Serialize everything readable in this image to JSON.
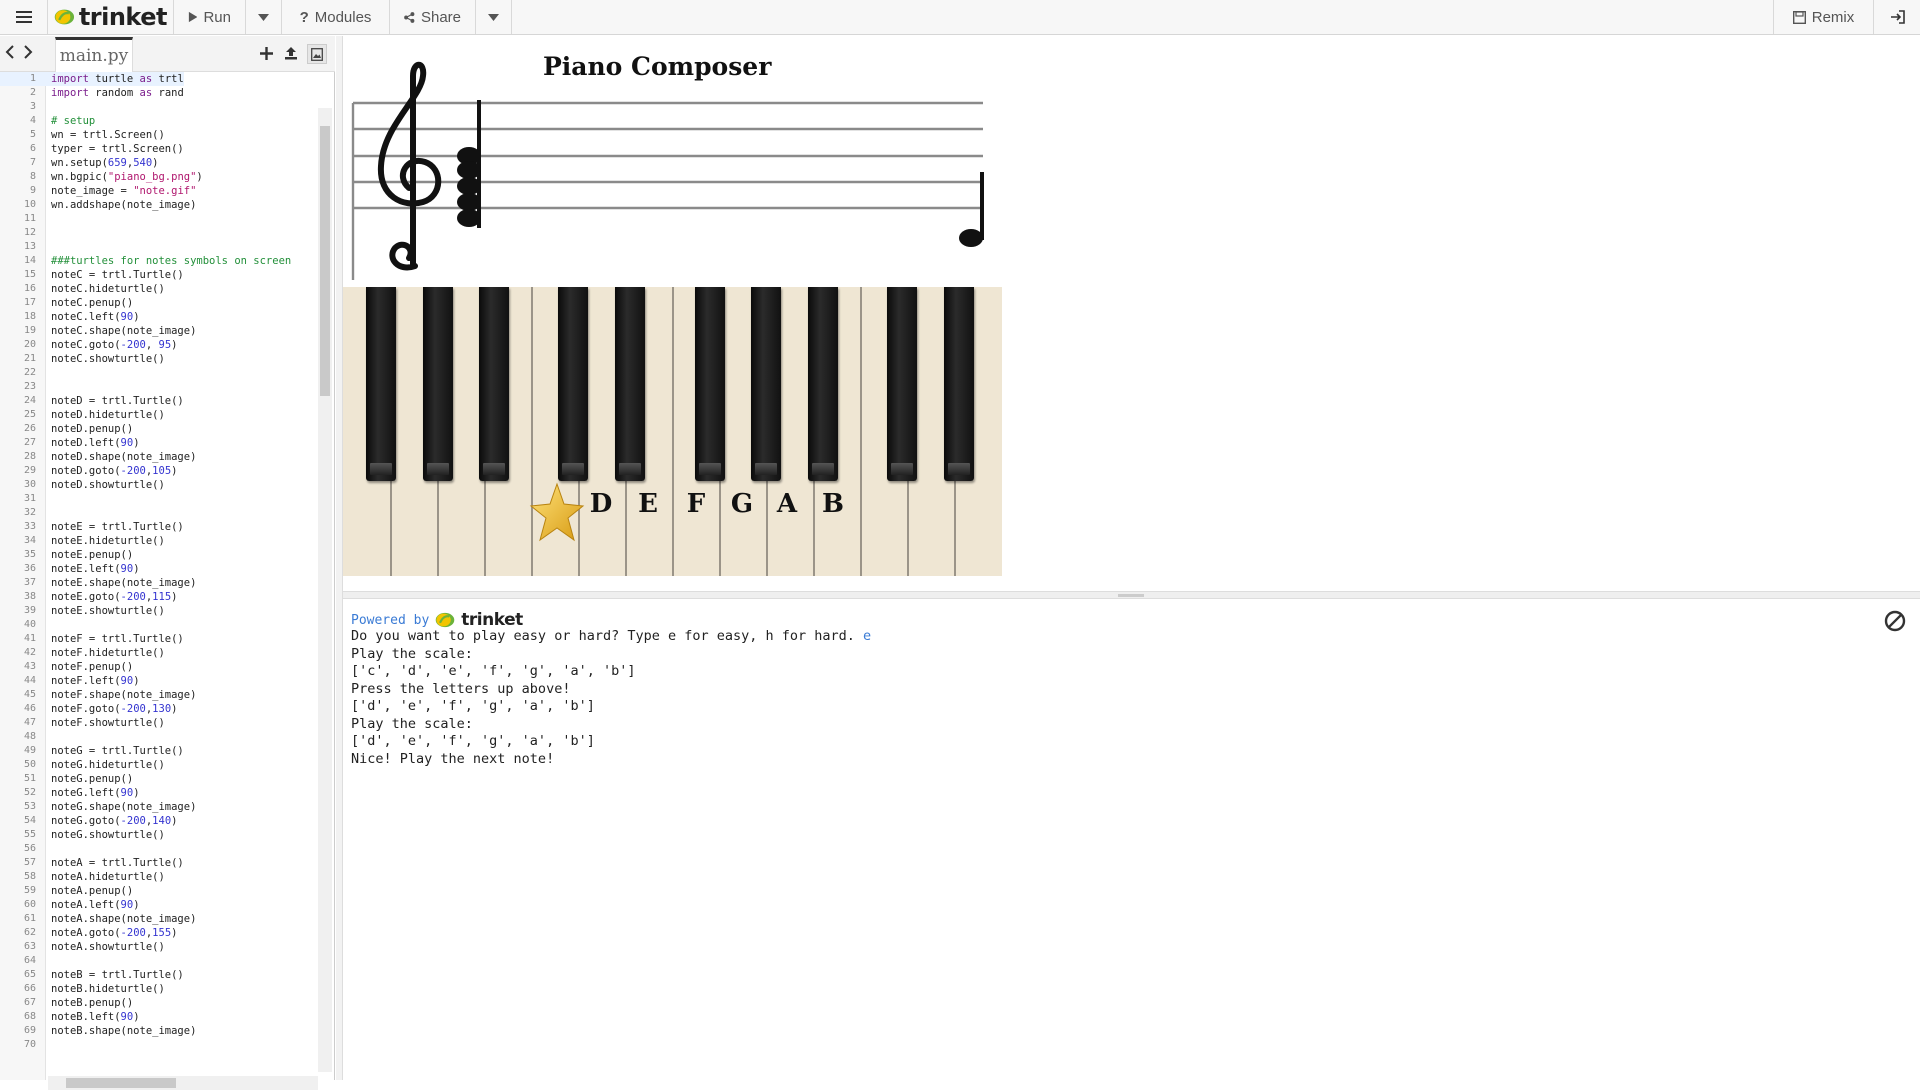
{
  "topbar": {
    "brand": "trinket",
    "run_label": "Run",
    "modules_label": "Modules",
    "share_label": "Share",
    "remix_label": "Remix"
  },
  "editor": {
    "tab_label": "main.py",
    "lines": [
      [
        [
          "k",
          "import"
        ],
        [
          "t",
          " turtle "
        ],
        [
          "k",
          "as"
        ],
        [
          "t",
          " trtl"
        ]
      ],
      [
        [
          "k",
          "import"
        ],
        [
          "t",
          " random "
        ],
        [
          "k",
          "as"
        ],
        [
          "t",
          " rand"
        ]
      ],
      [],
      [
        [
          "c",
          "# setup"
        ]
      ],
      [
        [
          "t",
          "wn = trtl.Screen()"
        ]
      ],
      [
        [
          "t",
          "typer = trtl.Screen()"
        ]
      ],
      [
        [
          "t",
          "wn.setup("
        ],
        [
          "n",
          "659"
        ],
        [
          "t",
          ","
        ],
        [
          "n",
          "540"
        ],
        [
          "t",
          ")"
        ]
      ],
      [
        [
          "t",
          "wn.bgpic("
        ],
        [
          "s",
          "\"piano_bg.png\""
        ],
        [
          "t",
          ")"
        ]
      ],
      [
        [
          "t",
          "note_image = "
        ],
        [
          "s",
          "\"note.gif\""
        ]
      ],
      [
        [
          "t",
          "wn.addshape(note_image)"
        ]
      ],
      [],
      [],
      [],
      [
        [
          "c",
          "###turtles for notes symbols on screen"
        ]
      ],
      [
        [
          "t",
          "noteC = trtl.Turtle()"
        ]
      ],
      [
        [
          "t",
          "noteC.hideturtle()"
        ]
      ],
      [
        [
          "t",
          "noteC.penup()"
        ]
      ],
      [
        [
          "t",
          "noteC.left("
        ],
        [
          "n",
          "90"
        ],
        [
          "t",
          ")"
        ]
      ],
      [
        [
          "t",
          "noteC.shape(note_image)"
        ]
      ],
      [
        [
          "t",
          "noteC.goto("
        ],
        [
          "n",
          "-200"
        ],
        [
          "t",
          ", "
        ],
        [
          "n",
          "95"
        ],
        [
          "t",
          ")"
        ]
      ],
      [
        [
          "t",
          "noteC.showturtle()"
        ]
      ],
      [],
      [],
      [
        [
          "t",
          "noteD = trtl.Turtle()"
        ]
      ],
      [
        [
          "t",
          "noteD.hideturtle()"
        ]
      ],
      [
        [
          "t",
          "noteD.penup()"
        ]
      ],
      [
        [
          "t",
          "noteD.left("
        ],
        [
          "n",
          "90"
        ],
        [
          "t",
          ")"
        ]
      ],
      [
        [
          "t",
          "noteD.shape(note_image)"
        ]
      ],
      [
        [
          "t",
          "noteD.goto("
        ],
        [
          "n",
          "-200"
        ],
        [
          "t",
          ","
        ],
        [
          "n",
          "105"
        ],
        [
          "t",
          ")"
        ]
      ],
      [
        [
          "t",
          "noteD.showturtle()"
        ]
      ],
      [],
      [],
      [
        [
          "t",
          "noteE = trtl.Turtle()"
        ]
      ],
      [
        [
          "t",
          "noteE.hideturtle()"
        ]
      ],
      [
        [
          "t",
          "noteE.penup()"
        ]
      ],
      [
        [
          "t",
          "noteE.left("
        ],
        [
          "n",
          "90"
        ],
        [
          "t",
          ")"
        ]
      ],
      [
        [
          "t",
          "noteE.shape(note_image)"
        ]
      ],
      [
        [
          "t",
          "noteE.goto("
        ],
        [
          "n",
          "-200"
        ],
        [
          "t",
          ","
        ],
        [
          "n",
          "115"
        ],
        [
          "t",
          ")"
        ]
      ],
      [
        [
          "t",
          "noteE.showturtle()"
        ]
      ],
      [],
      [
        [
          "t",
          "noteF = trtl.Turtle()"
        ]
      ],
      [
        [
          "t",
          "noteF.hideturtle()"
        ]
      ],
      [
        [
          "t",
          "noteF.penup()"
        ]
      ],
      [
        [
          "t",
          "noteF.left("
        ],
        [
          "n",
          "90"
        ],
        [
          "t",
          ")"
        ]
      ],
      [
        [
          "t",
          "noteF.shape(note_image)"
        ]
      ],
      [
        [
          "t",
          "noteF.goto("
        ],
        [
          "n",
          "-200"
        ],
        [
          "t",
          ","
        ],
        [
          "n",
          "130"
        ],
        [
          "t",
          ")"
        ]
      ],
      [
        [
          "t",
          "noteF.showturtle()"
        ]
      ],
      [],
      [
        [
          "t",
          "noteG = trtl.Turtle()"
        ]
      ],
      [
        [
          "t",
          "noteG.hideturtle()"
        ]
      ],
      [
        [
          "t",
          "noteG.penup()"
        ]
      ],
      [
        [
          "t",
          "noteG.left("
        ],
        [
          "n",
          "90"
        ],
        [
          "t",
          ")"
        ]
      ],
      [
        [
          "t",
          "noteG.shape(note_image)"
        ]
      ],
      [
        [
          "t",
          "noteG.goto("
        ],
        [
          "n",
          "-200"
        ],
        [
          "t",
          ","
        ],
        [
          "n",
          "140"
        ],
        [
          "t",
          ")"
        ]
      ],
      [
        [
          "t",
          "noteG.showturtle()"
        ]
      ],
      [],
      [
        [
          "t",
          "noteA = trtl.Turtle()"
        ]
      ],
      [
        [
          "t",
          "noteA.hideturtle()"
        ]
      ],
      [
        [
          "t",
          "noteA.penup()"
        ]
      ],
      [
        [
          "t",
          "noteA.left("
        ],
        [
          "n",
          "90"
        ],
        [
          "t",
          ")"
        ]
      ],
      [
        [
          "t",
          "noteA.shape(note_image)"
        ]
      ],
      [
        [
          "t",
          "noteA.goto("
        ],
        [
          "n",
          "-200"
        ],
        [
          "t",
          ","
        ],
        [
          "n",
          "155"
        ],
        [
          "t",
          ")"
        ]
      ],
      [
        [
          "t",
          "noteA.showturtle()"
        ]
      ],
      [],
      [
        [
          "t",
          "noteB = trtl.Turtle()"
        ]
      ],
      [
        [
          "t",
          "noteB.hideturtle()"
        ]
      ],
      [
        [
          "t",
          "noteB.penup()"
        ]
      ],
      [
        [
          "t",
          "noteB.left("
        ],
        [
          "n",
          "90"
        ],
        [
          "t",
          ")"
        ]
      ],
      [
        [
          "t",
          "noteB.shape(note_image)"
        ]
      ],
      []
    ]
  },
  "canvas": {
    "title": "Piano Composer",
    "note_labels": [
      "D",
      "E",
      "F",
      "G",
      "A",
      "B"
    ]
  },
  "console": {
    "powered_by": "Powered by",
    "brand": "trinket",
    "output": [
      {
        "text": "Do you want to play easy or hard? Type e for easy, h for hard. ",
        "input": "e"
      },
      {
        "text": "Play the scale:"
      },
      {
        "text": "['c', 'd', 'e', 'f', 'g', 'a', 'b']"
      },
      {
        "text": "Press the letters up above!"
      },
      {
        "text": "['d', 'e', 'f', 'g', 'a', 'b']"
      },
      {
        "text": "Play the scale:"
      },
      {
        "text": "['d', 'e', 'f', 'g', 'a', 'b']"
      },
      {
        "text": "Nice! Play the next note!"
      }
    ]
  },
  "icons": {
    "menu": "hamburger-icon",
    "run": "play-icon",
    "modules": "question-icon",
    "share": "share-icon",
    "remix": "save-icon",
    "login": "sign-in-icon",
    "clear": "clear-console-icon"
  },
  "colors": {
    "accent_blue": "#3a7bd5",
    "logo_yellow": "#f2c500",
    "logo_green": "#6bb33a",
    "key_ivory": "#efe6d3"
  }
}
